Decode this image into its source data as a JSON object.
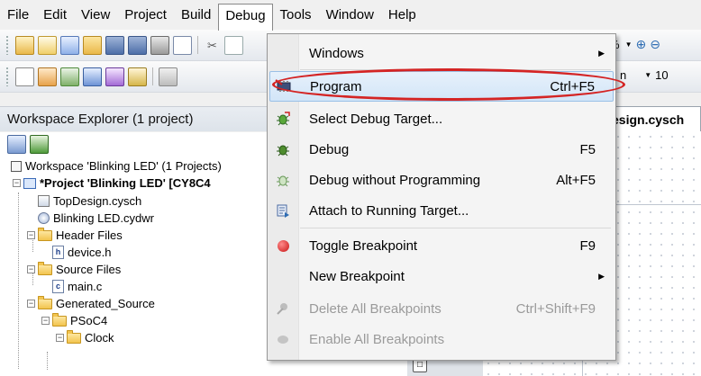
{
  "menubar": {
    "items": [
      {
        "key": "file",
        "label": "File"
      },
      {
        "key": "edit",
        "label": "Edit"
      },
      {
        "key": "view",
        "label": "View"
      },
      {
        "key": "project",
        "label": "Project"
      },
      {
        "key": "build",
        "label": "Build"
      },
      {
        "key": "debug",
        "label": "Debug"
      },
      {
        "key": "tools",
        "label": "Tools"
      },
      {
        "key": "window",
        "label": "Window"
      },
      {
        "key": "help",
        "label": "Help"
      }
    ]
  },
  "toolbar": {
    "zoom_text": "%",
    "font_combo_partial": "n",
    "size_value": "10"
  },
  "workspace": {
    "title": "Workspace Explorer (1 project)",
    "tree": [
      {
        "label": "Workspace 'Blinking LED' (1 Projects)"
      },
      {
        "label": "*Project  'Blinking LED' [CY8C4"
      },
      {
        "label": "TopDesign.cysch"
      },
      {
        "label": "Blinking LED.cydwr"
      },
      {
        "label": "Header Files"
      },
      {
        "label": "device.h"
      },
      {
        "label": "Source Files"
      },
      {
        "label": "main.c"
      },
      {
        "label": "Generated_Source"
      },
      {
        "label": "PSoC4"
      },
      {
        "label": "Clock"
      }
    ]
  },
  "editor": {
    "tab_label": "esign.cysch"
  },
  "debug_menu": {
    "items": [
      {
        "label": "Windows",
        "shortcut": "",
        "submenu": true,
        "enabled": true
      },
      {
        "label": "Program",
        "shortcut": "Ctrl+F5",
        "submenu": false,
        "enabled": true,
        "highlighted": true
      },
      {
        "label": "Select Debug Target...",
        "shortcut": "",
        "submenu": false,
        "enabled": true
      },
      {
        "label": "Debug",
        "shortcut": "F5",
        "submenu": false,
        "enabled": true
      },
      {
        "label": "Debug without Programming",
        "shortcut": "Alt+F5",
        "submenu": false,
        "enabled": true
      },
      {
        "label": "Attach to Running Target...",
        "shortcut": "",
        "submenu": false,
        "enabled": true
      },
      {
        "label": "Toggle Breakpoint",
        "shortcut": "F9",
        "submenu": false,
        "enabled": true
      },
      {
        "label": "New Breakpoint",
        "shortcut": "",
        "submenu": true,
        "enabled": true
      },
      {
        "label": "Delete All Breakpoints",
        "shortcut": "Ctrl+Shift+F9",
        "submenu": false,
        "enabled": false
      },
      {
        "label": "Enable All Breakpoints",
        "shortcut": "",
        "submenu": false,
        "enabled": false
      }
    ]
  },
  "colors": {
    "highlight_ring": "#d42424",
    "menu_highlight": "#d2e5f8"
  }
}
